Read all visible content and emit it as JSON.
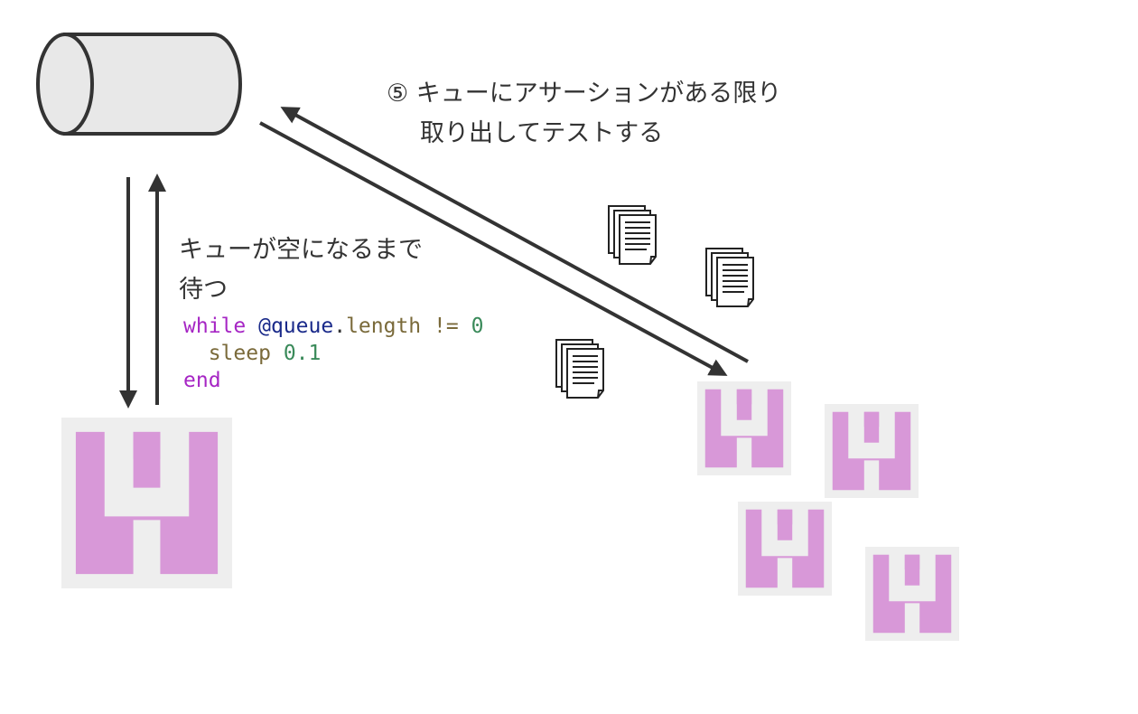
{
  "labels": {
    "step5_line1": "⑤ キューにアサーションがある限り",
    "step5_line2": "取り出してテストする",
    "wait_line1": "キューが空になるまで",
    "wait_line2": "待つ"
  },
  "code": {
    "line1": {
      "kw": "while",
      "ivar": "@queue",
      "dot": ".",
      "meth": "length",
      "op": "!=",
      "num": "0"
    },
    "line2": {
      "meth": "sleep",
      "num": "0.1"
    },
    "line3": {
      "kw": "end"
    }
  },
  "colors": {
    "logo_pink": "#d898d8",
    "logo_bg": "#eeeeee",
    "arrow": "#333333",
    "cylinder_fill": "#e8e8e8"
  },
  "icons": {
    "queue": "database-cylinder-icon",
    "main_process": "pink-castle-logo-icon",
    "worker": "pink-castle-logo-icon",
    "assertion": "document-stack-icon"
  }
}
